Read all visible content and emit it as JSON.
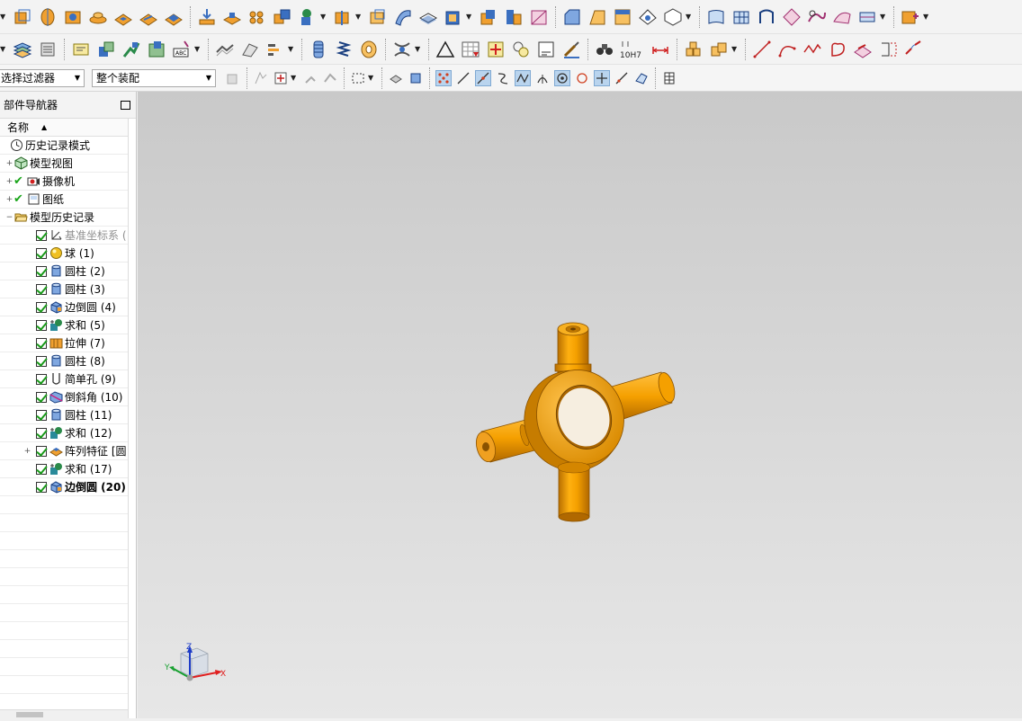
{
  "toolbar": {
    "selection_filter": "选择过滤器",
    "assembly_scope": "整个装配"
  },
  "navigator": {
    "title": "部件导航器",
    "column_name": "名称",
    "items": [
      {
        "label": "历史记录模式",
        "icon": "clock-icon"
      },
      {
        "label": "模型视图",
        "icon": "model-views-icon"
      },
      {
        "label": "摄像机",
        "icon": "camera-icon"
      },
      {
        "label": "图纸",
        "icon": "drawing-sheet-icon"
      },
      {
        "label": "模型历史记录",
        "icon": "folder-open-icon"
      },
      {
        "label": "基准坐标系 (",
        "icon": "datum-csys-icon"
      },
      {
        "label": "球 (1)",
        "icon": "sphere-icon"
      },
      {
        "label": "圆柱 (2)",
        "icon": "cylinder-icon"
      },
      {
        "label": "圆柱 (3)",
        "icon": "cylinder-icon"
      },
      {
        "label": "边倒圆 (4)",
        "icon": "edge-blend-icon"
      },
      {
        "label": "求和 (5)",
        "icon": "unite-icon"
      },
      {
        "label": "拉伸 (7)",
        "icon": "extrude-icon"
      },
      {
        "label": "圆柱 (8)",
        "icon": "cylinder-icon"
      },
      {
        "label": "简单孔 (9)",
        "icon": "simple-hole-icon"
      },
      {
        "label": "倒斜角 (10)",
        "icon": "chamfer-icon"
      },
      {
        "label": "圆柱 (11)",
        "icon": "cylinder-icon"
      },
      {
        "label": "求和 (12)",
        "icon": "unite-icon"
      },
      {
        "label": "阵列特征 [圆",
        "icon": "pattern-feature-icon"
      },
      {
        "label": "求和 (17)",
        "icon": "unite-icon"
      },
      {
        "label": "边倒圆 (20)",
        "icon": "edge-blend-icon"
      }
    ]
  },
  "triad": {
    "x": "X",
    "y": "Y",
    "z": "Z"
  },
  "colors": {
    "part": "#f5a000",
    "part_dark": "#c57a00",
    "accent": "#1a9a1a"
  }
}
